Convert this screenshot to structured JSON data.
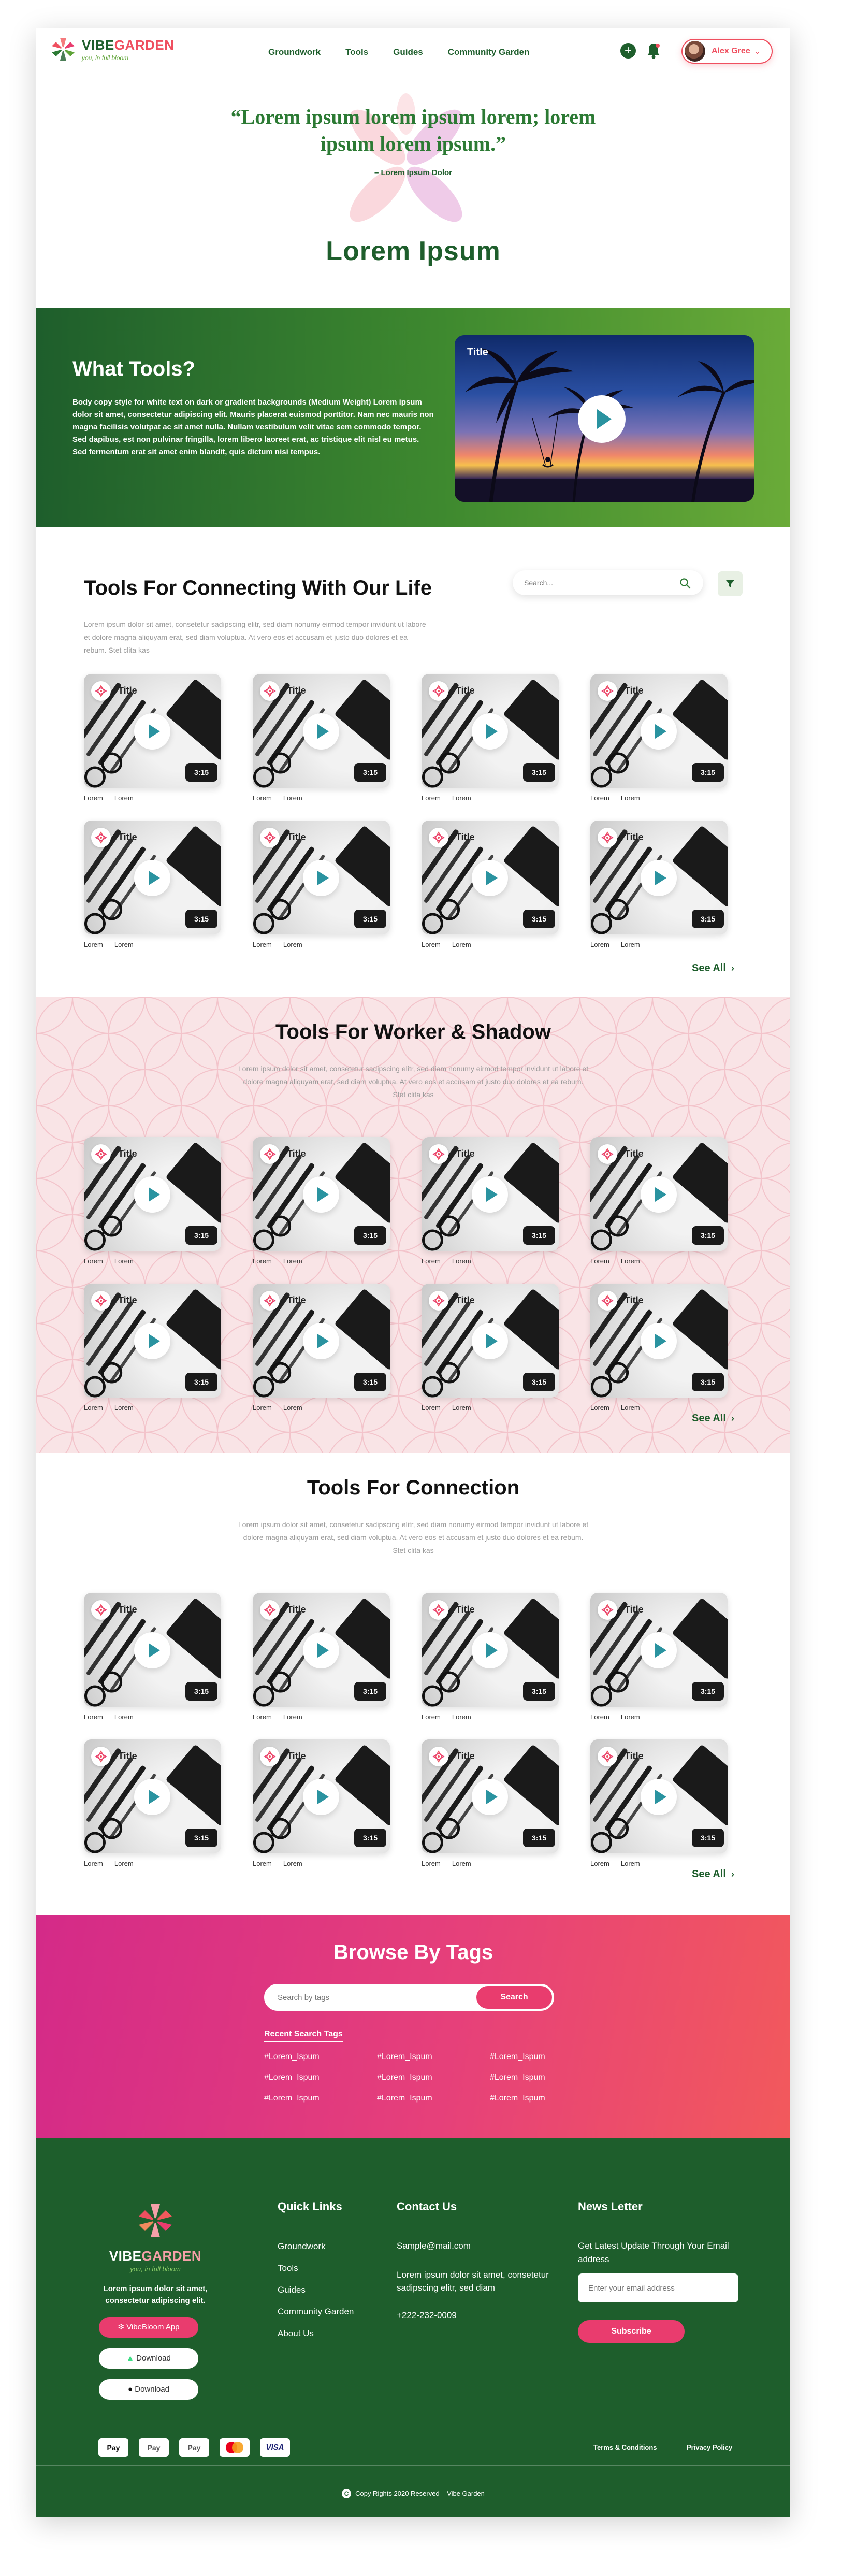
{
  "nav": {
    "brand_vibe": "VIBE",
    "brand_garden": "GARDEN",
    "brand_tagline": "you, in full bloom",
    "links": [
      "Groundwork",
      "Tools",
      "Guides",
      "Community Garden"
    ],
    "add_symbol": "+",
    "user_name": "Alex Gree",
    "user_chevron": "⌄"
  },
  "hero": {
    "quote": "“Lorem ipsum lorem ipsum lorem; lorem ipsum lorem ipsum.”",
    "author": "– Lorem Ipsum Dolor",
    "title": "Lorem Ipsum"
  },
  "what_tools": {
    "title": "What Tools?",
    "body": "Body copy style for white text on dark or gradient backgrounds (Medium Weight) Lorem ipsum dolor sit amet, consectetur adipiscing elit. Mauris placerat euismod porttitor. Nam nec mauris non magna facilisis volutpat ac sit amet nulla. Nullam vestibulum velit vitae sem commodo tempor. Sed dapibus, est non pulvinar fringilla, lorem libero laoreet erat, ac tristique elit nisl eu metus. Sed fermentum erat sit amet enim blandit, quis dictum nisi tempus.",
    "video_title": "Title"
  },
  "section1": {
    "title": "Tools For Connecting With Our Life",
    "description": "Lorem ipsum dolor sit amet, consetetur sadipscing elitr, sed diam nonumy eirmod tempor invidunt ut labore et dolore magna aliquyam erat, sed diam voluptua. At vero eos et accusam et justo duo dolores et ea rebum. Stet clita kas",
    "search_placeholder": "Search...",
    "see_all": "See All",
    "chevron": "›"
  },
  "section2": {
    "title": "Tools For Worker & Shadow",
    "description": "Lorem ipsum dolor sit amet, consetetur sadipscing elitr, sed diam nonumy eirmod tempor invidunt ut labore et dolore magna aliquyam erat, sed diam voluptua. At vero eos et accusam et justo duo dolores et ea rebum. Stet clita kas",
    "see_all": "See All",
    "chevron": "›"
  },
  "section3": {
    "title": "Tools For Connection",
    "description": "Lorem ipsum dolor sit amet, consetetur sadipscing elitr, sed diam nonumy eirmod tempor invidunt ut labore et dolore magna aliquyam erat, sed diam voluptua. At vero eos et accusam et justo duo dolores et ea rebum. Stet clita kas",
    "see_all": "See All",
    "chevron": "›"
  },
  "card": {
    "title": "Title",
    "duration": "3:15",
    "meta_a": "Lorem",
    "meta_b": "Lorem"
  },
  "tags": {
    "title": "Browse By Tags",
    "search_placeholder": "Search by tags",
    "search_button": "Search",
    "recent_title": "Recent Search Tags",
    "items": [
      "#Lorem_Ispum",
      "#Lorem_Ispum",
      "#Lorem_Ispum",
      "#Lorem_Ispum",
      "#Lorem_Ispum",
      "#Lorem_Ispum",
      "#Lorem_Ispum",
      "#Lorem_Ispum",
      "#Lorem_Ispum"
    ]
  },
  "footer": {
    "brand_vibe": "VIBE",
    "brand_garden": "GARDEN",
    "brand_tagline": "you, in full bloom",
    "description": "Lorem ipsum dolor sit amet, consectetur adipiscing elit.",
    "app_button": "VibeBloom App",
    "download_android": "Download",
    "download_ios": "Download",
    "quick_links_title": "Quick Links",
    "quick_links": [
      "Groundwork",
      "Tools",
      "Guides",
      "Community Garden",
      "About Us"
    ],
    "contact_title": "Contact Us",
    "contact_email": "Sample@mail.com",
    "contact_address": "Lorem ipsum dolor sit amet, consetetur sadipscing elitr, sed diam",
    "contact_phone": "+222-232-0009",
    "newsletter_title": "News Letter",
    "newsletter_text": "Get Latest Update Through Your Email address",
    "email_placeholder": "Enter your email address",
    "subscribe": "Subscribe",
    "payments": [
      "Pay",
      "Pay",
      "Pay",
      "VISA"
    ],
    "terms": "Terms & Conditions",
    "privacy": "Privacy Policy",
    "copyright": "Copy Rights 2020 Reserved – Vibe Garden",
    "copyright_symbol": "C"
  },
  "colors": {
    "primary_green": "#1e5e2c",
    "light_green": "#6aab38",
    "accent_pink": "#e93c6e",
    "coral": "#ef4f5f",
    "play_teal": "#2a93a0",
    "blush": "#f9e4e6"
  },
  "icons": {
    "logo": "vibe-garden-flower-icon",
    "bell": "bell-icon",
    "search": "search-icon",
    "filter": "filter-icon",
    "play": "play-icon",
    "badge": "flower-badge-icon"
  }
}
